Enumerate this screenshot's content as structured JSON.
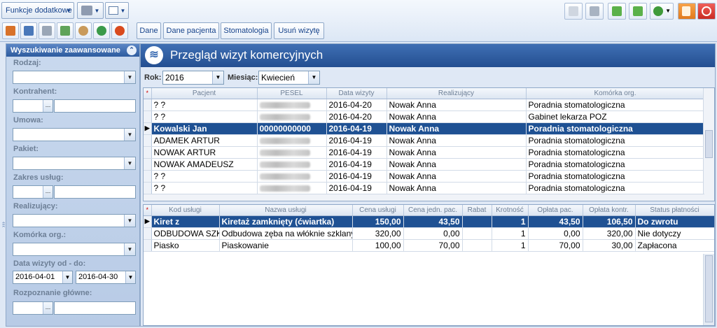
{
  "toolbar": {
    "functions_label": "Funkcje dodatkowe",
    "tabs": [
      "Dane",
      "Dane pacjenta",
      "Stomatologia",
      "Usuń wizytę"
    ]
  },
  "search_panel": {
    "title": "Wyszukiwanie zaawansowane",
    "fields": {
      "rodzaj": "Rodzaj:",
      "kontrahent": "Kontrahent:",
      "umowa": "Umowa:",
      "pakiet": "Pakiet:",
      "zakres": "Zakres usług:",
      "realizujacy": "Realizujący:",
      "komorka": "Komórka org.:",
      "data": "Data wizyty od - do:",
      "rozpoznanie": "Rozpoznanie główne:"
    },
    "date_from": "2016-04-01",
    "date_to": "2016-04-30"
  },
  "main": {
    "title": "Przegląd wizyt komercyjnych",
    "rok_label": "Rok:",
    "rok_value": "2016",
    "miesiac_label": "Miesiąc:",
    "miesiac_value": "Kwiecień"
  },
  "visits": {
    "headers": [
      "Pacjent",
      "PESEL",
      "Data wizyty",
      "Realizujący",
      "Komórka org."
    ],
    "rows": [
      [
        "? ?",
        "",
        "2016-04-20",
        "Nowak Anna",
        "Poradnia stomatologiczna"
      ],
      [
        "? ?",
        "",
        "2016-04-20",
        "Nowak Anna",
        "Gabinet lekarza POZ"
      ],
      [
        "Kowalski Jan",
        "00000000000",
        "2016-04-19",
        "Nowak Anna",
        "Poradnia stomatologiczna"
      ],
      [
        "ADAMEK ARTUR",
        "",
        "2016-04-19",
        "Nowak Anna",
        "Poradnia stomatologiczna"
      ],
      [
        "NOWAK ARTUR",
        "",
        "2016-04-19",
        "Nowak Anna",
        "Poradnia stomatologiczna"
      ],
      [
        "NOWAK AMADEUSZ",
        "",
        "2016-04-19",
        "Nowak Anna",
        "Poradnia stomatologiczna"
      ],
      [
        "? ?",
        "",
        "2016-04-19",
        "Nowak Anna",
        "Poradnia stomatologiczna"
      ],
      [
        "? ?",
        "",
        "2016-04-19",
        "Nowak Anna",
        "Poradnia stomatologiczna"
      ]
    ]
  },
  "services": {
    "headers": [
      "Kod usługi",
      "Nazwa usługi",
      "Cena usługi",
      "Cena jedn. pac.",
      "Rabat",
      "Krotność",
      "Opłata pac.",
      "Opłata kontr.",
      "Status płatności"
    ],
    "rows": [
      [
        "Kiret z",
        "Kiretaż zamknięty (ćwiartka)",
        "150,00",
        "43,50",
        "",
        "1",
        "43,50",
        "106,50",
        "Do zwrotu"
      ],
      [
        "ODBUDOWA SZKL",
        "Odbudowa zęba na włóknie szklanym",
        "320,00",
        "0,00",
        "",
        "1",
        "0,00",
        "320,00",
        "Nie dotyczy"
      ],
      [
        "Piasko",
        "Piaskowanie",
        "100,00",
        "70,00",
        "",
        "1",
        "70,00",
        "30,00",
        "Zapłacona"
      ]
    ]
  }
}
